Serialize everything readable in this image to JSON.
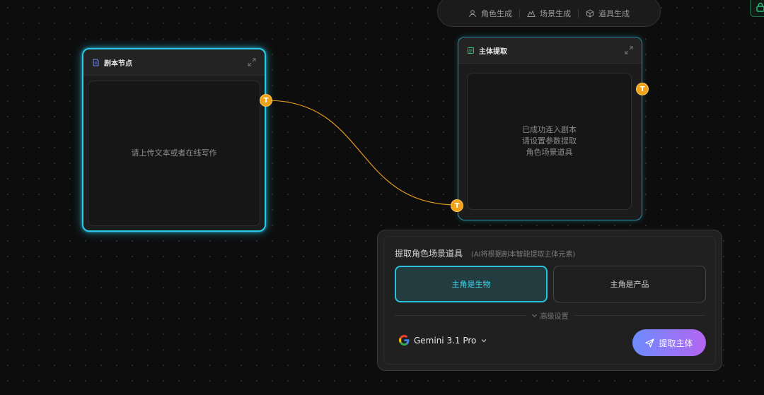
{
  "toolbar": {
    "items": [
      {
        "label": "角色生成",
        "icon": "user-icon"
      },
      {
        "label": "场景生成",
        "icon": "scene-icon"
      },
      {
        "label": "道具生成",
        "icon": "cube-icon"
      }
    ]
  },
  "node_script": {
    "title": "剧本节点",
    "placeholder": "请上传文本或者在线写作",
    "port_label": "T"
  },
  "node_extract": {
    "title": "主体提取",
    "message_lines": [
      "已成功连入剧本",
      "请设置参数提取",
      "角色场景道具"
    ],
    "port_label": "T"
  },
  "wire_port_label": "T",
  "panel": {
    "title": "提取角色场景道具",
    "subtitle": "(AI将根据剧本智能提取主体元素)",
    "option_living": "主角是生物",
    "option_product": "主角是产品",
    "advanced_label": "高级设置",
    "model_name": "Gemini 3.1 Pro",
    "extract_button": "提取主体"
  },
  "colors": {
    "accent_cyan": "#2bc7e6",
    "port_orange": "#f0a21a",
    "button_gradient_start": "#6d8cff",
    "button_gradient_end": "#b465f0"
  }
}
